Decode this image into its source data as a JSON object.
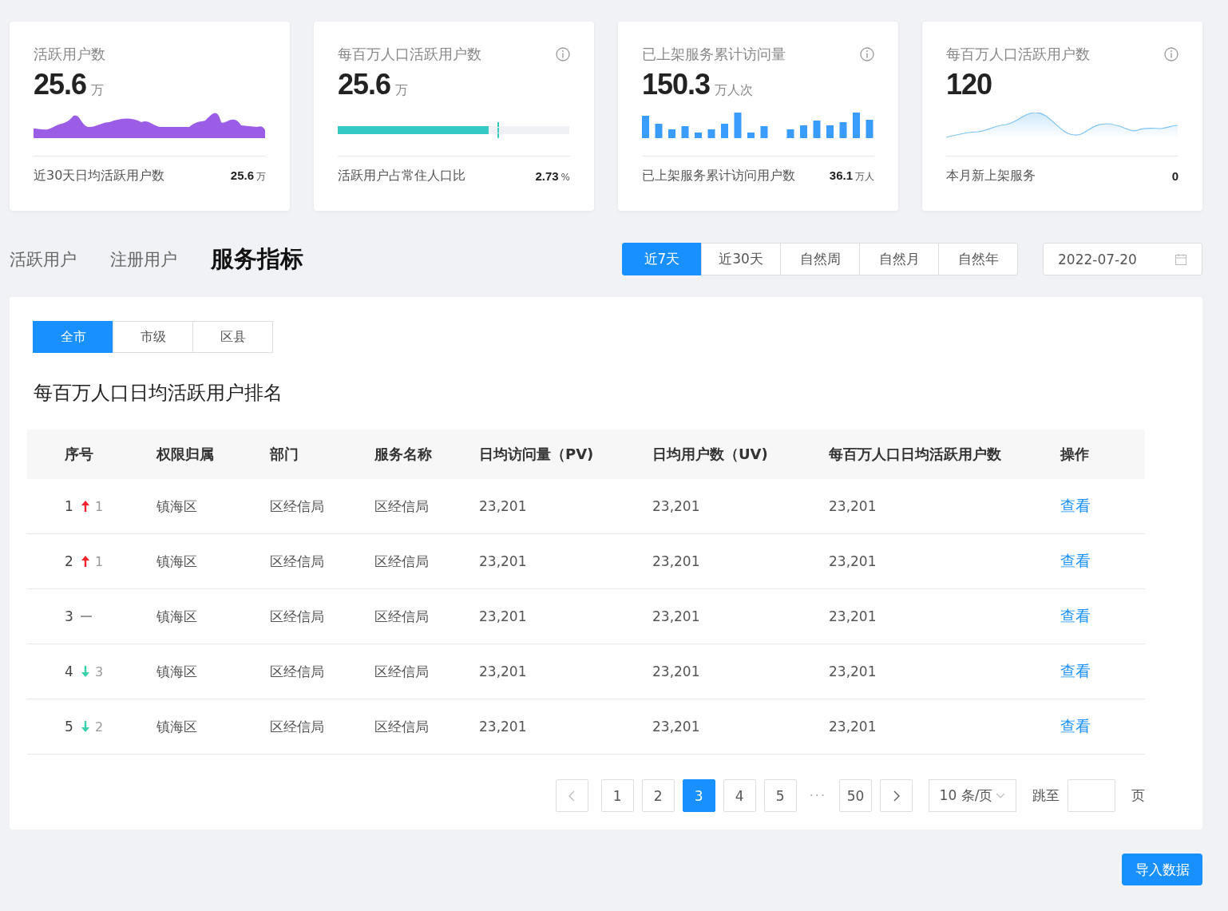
{
  "cards": [
    {
      "kind": "area",
      "title": "活跃用户数",
      "info": false,
      "value": "25.6",
      "unit": "万",
      "footer_label": "近30天日均活跃用户数",
      "footer_value": "25.6",
      "footer_unit": "万"
    },
    {
      "kind": "progress",
      "title": "每百万人口活跃用户数",
      "info": true,
      "value": "25.6",
      "unit": "万",
      "level": 0.65,
      "footer_label": "活跃用户占常住人口比",
      "footer_value": "2.73",
      "footer_unit": "%"
    },
    {
      "kind": "bars",
      "title": "已上架服务累计访问量",
      "info": true,
      "value": "150.3",
      "unit": "万人次",
      "footer_label": "已上架服务累计访问用户数",
      "footer_value": "36.1",
      "footer_unit": "万人"
    },
    {
      "kind": "line",
      "title": "每百万人口活跃用户数",
      "info": true,
      "value": "120",
      "footer_label": "本月新上架服务",
      "footer_value": "0"
    }
  ],
  "section_tabs": [
    {
      "label": "活跃用户",
      "selected": false
    },
    {
      "label": "注册用户",
      "selected": false
    },
    {
      "label": "服务指标",
      "selected": true
    }
  ],
  "periods": [
    {
      "label": "近7天",
      "selected": true
    },
    {
      "label": "近30天",
      "selected": false
    },
    {
      "label": "自然周",
      "selected": false
    },
    {
      "label": "自然月",
      "selected": false
    },
    {
      "label": "自然年",
      "selected": false
    }
  ],
  "date": "2022-07-20",
  "scopes": [
    {
      "label": "全市",
      "selected": true
    },
    {
      "label": "市级",
      "selected": false
    },
    {
      "label": "区县",
      "selected": false
    }
  ],
  "table_title": "每百万人口日均活跃用户排名",
  "columns": [
    "序号",
    "权限归属",
    "部门",
    "服务名称",
    "日均访问量（PV)",
    "日均用户数（UV)",
    "每百万人口日均活跃用户数",
    "操作"
  ],
  "rows": [
    {
      "rank": "1",
      "kind": "up",
      "change": "1",
      "owner": "镇海区",
      "dept": "区经信局",
      "service": "区经信局",
      "pv": "23,201",
      "uv": "23,201",
      "per_million": "23,201",
      "action": "查看"
    },
    {
      "rank": "2",
      "kind": "up",
      "change": "1",
      "owner": "镇海区",
      "dept": "区经信局",
      "service": "区经信局",
      "pv": "23,201",
      "uv": "23,201",
      "per_million": "23,201",
      "action": "查看"
    },
    {
      "rank": "3",
      "kind": "flat",
      "owner": "镇海区",
      "dept": "区经信局",
      "service": "区经信局",
      "pv": "23,201",
      "uv": "23,201",
      "per_million": "23,201",
      "action": "查看"
    },
    {
      "rank": "4",
      "kind": "down",
      "change": "3",
      "owner": "镇海区",
      "dept": "区经信局",
      "service": "区经信局",
      "pv": "23,201",
      "uv": "23,201",
      "per_million": "23,201",
      "action": "查看"
    },
    {
      "rank": "5",
      "kind": "down",
      "change": "2",
      "owner": "镇海区",
      "dept": "区经信局",
      "service": "区经信局",
      "pv": "23,201",
      "uv": "23,201",
      "per_million": "23,201",
      "action": "查看"
    }
  ],
  "pagination": {
    "pages": [
      {
        "label": "1",
        "selected": false
      },
      {
        "label": "2",
        "selected": false
      },
      {
        "label": "3",
        "selected": true
      },
      {
        "label": "4",
        "selected": false
      },
      {
        "label": "5",
        "selected": false
      }
    ],
    "ellipsis": "···",
    "last": "50",
    "page_size": "10 条/页",
    "jump_label": "跳至",
    "jump_suffix": "页"
  },
  "import_button": "导入数据"
}
